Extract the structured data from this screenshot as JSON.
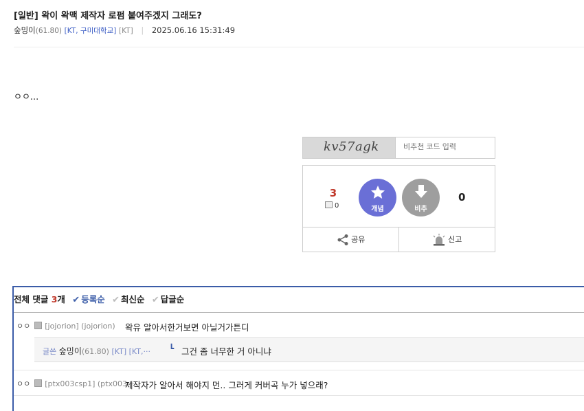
{
  "post": {
    "title": "[일반] 왁이 왁맥 제작자 로펌 붙여주겠지 그래도?",
    "author": "숲밍이",
    "score": "(61.80)",
    "carrier": "[KT, 구미대학교]",
    "carrier_tag": "[KT]",
    "separator": "|",
    "datetime": "2025.06.16 15:31:49",
    "body": "ㅇㅇ..."
  },
  "captcha": {
    "code_text": "kv57agk",
    "placeholder": "비추천 코드 입력"
  },
  "vote": {
    "up_count": "3",
    "fix_count": "0",
    "up_label": "개념",
    "down_label": "비추",
    "down_count": "0",
    "share_label": "공유",
    "report_label": "신고"
  },
  "comments": {
    "header_prefix": "전체 댓글",
    "count": "3",
    "count_suffix": "개",
    "sort_options": [
      {
        "label": "등록순",
        "active": true
      },
      {
        "label": "최신순",
        "active": false
      },
      {
        "label": "답글순",
        "active": false
      }
    ],
    "items": [
      {
        "nick": "ㅇㅇ",
        "id": "[jojorion] (jojorion)",
        "text": "왁유 알아서한거보면 아닐거가튼디"
      },
      {
        "nick": "ㅇㅇ",
        "id": "[ptx003csp1] (ptx003···",
        "text": "제작자가 알아서 해야지 먼.. 그러게 커버곡 누가 넣으래?"
      }
    ],
    "reply": {
      "label": "글쓴",
      "nick": "숲밍이",
      "score": "(61.80)",
      "tag": "[KT]",
      "tag2": "[KT,···",
      "arrow": "┗",
      "text": "그건 좀 너무한 거 아니냐"
    }
  },
  "colors": {
    "accent": "#3b5ca8",
    "up_button": "#6a6fd6",
    "down_button": "#9e9e9e",
    "count_red": "#c0392b"
  }
}
